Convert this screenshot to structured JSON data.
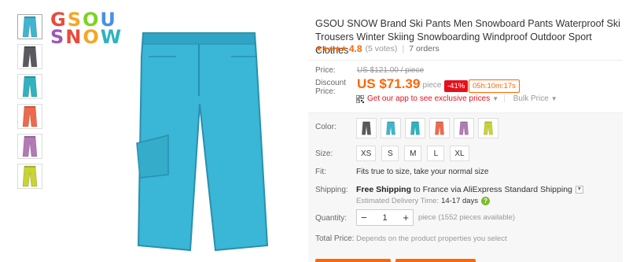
{
  "brand_logo": {
    "line1": [
      "G",
      "S",
      "O",
      "U"
    ],
    "line2": [
      "S",
      "N",
      "O",
      "W"
    ]
  },
  "product": {
    "title": "GSOU SNOW Brand Ski Pants Men Snowboard Pants Waterproof Ski Trousers Winter Skiing Snowboarding Windproof Outdoor Sport Clothes",
    "stars": "★★★★★",
    "rating": "4.8",
    "votes": "(5 votes)",
    "orders": "7 orders"
  },
  "price": {
    "price_label": "Price:",
    "discount_label": "Discount Price:",
    "original": "US $121.00 / piece",
    "current": "US $71.39",
    "unit": "/ piece",
    "discount": "-41%",
    "timer": "05h:10m:17s",
    "app_link": "Get our app to see exclusive prices",
    "bulk": "Bulk Price"
  },
  "options": {
    "color_label": "Color:",
    "size_label": "Size:",
    "fit_label": "Fit:",
    "shipping_label": "Shipping:",
    "quantity_label": "Quantity:",
    "total_label": "Total Price:",
    "colors": [
      "#5a5a5e",
      "#3fb5cf",
      "#2fb3bf",
      "#ee6a4c",
      "#b27ab6",
      "#c7d434"
    ],
    "sizes": [
      "XS",
      "S",
      "M",
      "L",
      "XL"
    ],
    "fit_text": "Fits true to size, take your normal size",
    "shipping_free": "Free Shipping",
    "shipping_rest": " to France via AliExpress Standard Shipping",
    "delivery_label": "Estimated Delivery Time:",
    "delivery_days": "14-17 days",
    "quantity": "1",
    "qty_note": "piece (1552 pieces available)",
    "total_text": "Depends on the product properties you select"
  },
  "thumbnails": [
    "#3fb5cf",
    "#5a5a5e",
    "#2fb3bf",
    "#ee6a4c",
    "#b27ab6",
    "#c7d434"
  ],
  "main_image_color": "#3ab6d6"
}
